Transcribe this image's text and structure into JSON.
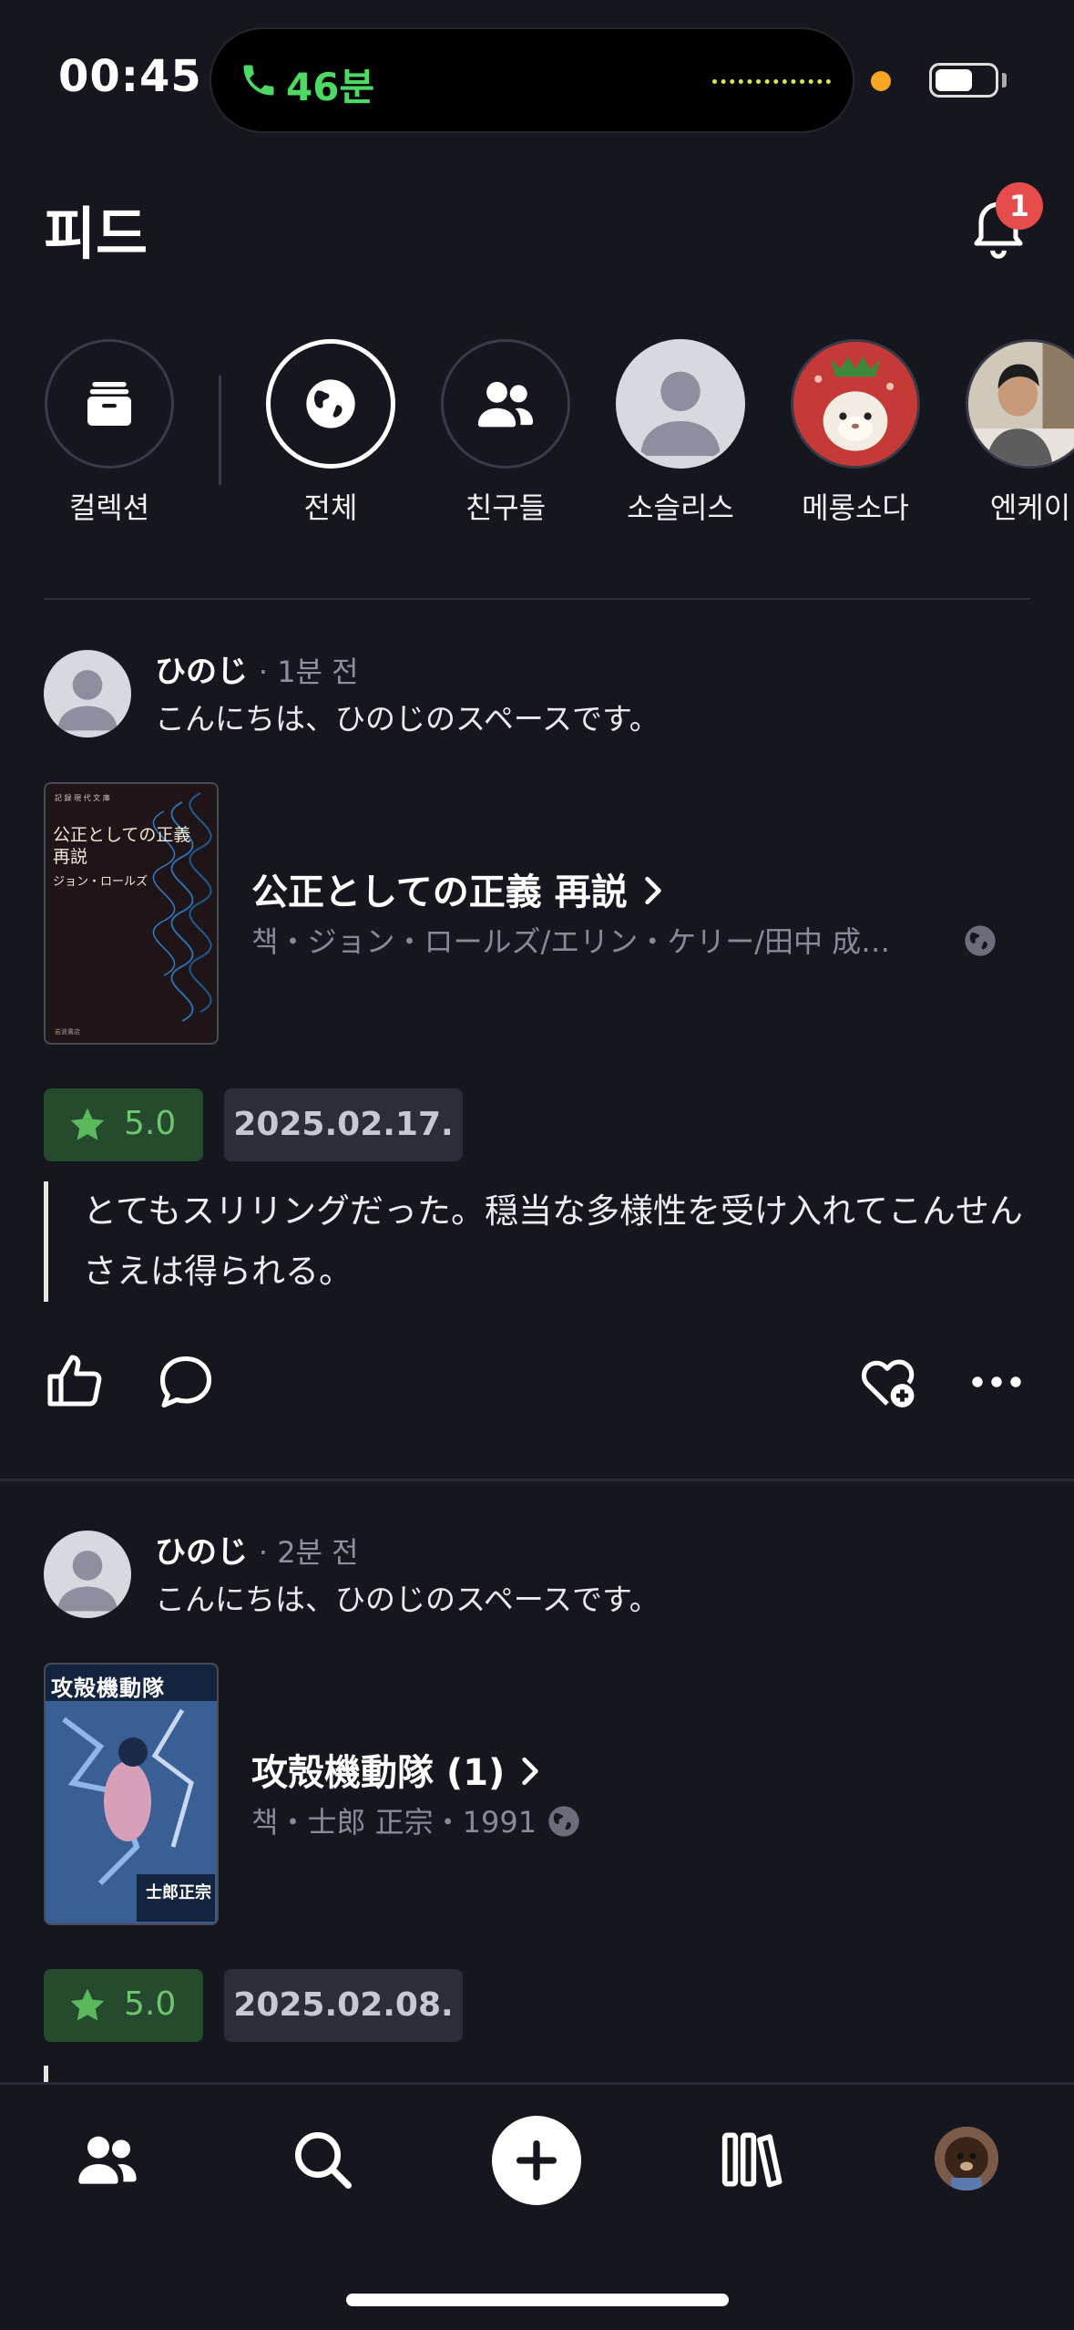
{
  "status_bar": {
    "time": "00:45",
    "call_duration": "46분"
  },
  "header": {
    "title": "피드",
    "notification_count": "1"
  },
  "stories": [
    {
      "label": "컬렉션",
      "icon": "archive-icon"
    },
    {
      "label": "전체",
      "icon": "globe-icon",
      "active": true
    },
    {
      "label": "친구들",
      "icon": "users-icon"
    },
    {
      "label": "소슬리스",
      "icon": "default-avatar"
    },
    {
      "label": "메롱소다",
      "icon": "strawberry-avatar"
    },
    {
      "label": "엔케이",
      "icon": "photo-avatar"
    }
  ],
  "posts": [
    {
      "user": "ひのじ",
      "time": "· 1분 전",
      "subtitle": "こんにちは、ひのじのスペースです。",
      "cover_title": "公正としての正義 再説",
      "cover_author": "ジョン・ロールズ",
      "book_title": "公正としての正義 再説",
      "book_meta": "책・ジョン・ロールズ/エリン・ケリー/田中 成…",
      "rating": "5.0",
      "date": "2025.02.17.",
      "review": "とてもスリリングだった。穏当な多様性を受け入れてこんせんさえは得られる。"
    },
    {
      "user": "ひのじ",
      "time": "· 2분 전",
      "subtitle": "こんにちは、ひのじのスペースです。",
      "cover_title": "攻殻機動隊",
      "cover_author": "士郎正宗",
      "book_title": "攻殻機動隊 (1)",
      "book_meta": "책・士郎 正宗・1991",
      "rating": "5.0",
      "date": "2025.02.08."
    }
  ],
  "colors": {
    "background": "#16161f",
    "rating_bg": "#254a2e",
    "rating_text": "#6fc46f",
    "badge": "#e74c4c",
    "call_green": "#4cd964"
  }
}
